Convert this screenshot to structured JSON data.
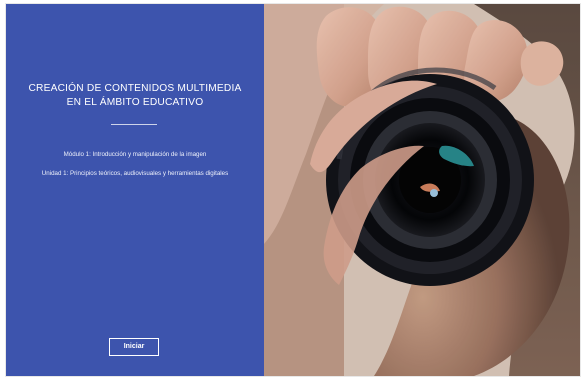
{
  "course": {
    "title": "CREACIÓN DE CONTENIDOS MULTIMEDIA EN EL ÁMBITO EDUCATIVO",
    "module": "Módulo 1: Introducción y manipulación de la imagen",
    "unit": "Unidad 1: Principios teóricos, audiovisuales y herramientas digitales"
  },
  "actions": {
    "start_label": "Iniciar"
  },
  "theme": {
    "panel_color": "#3d54ad",
    "text_color": "#ffffff"
  },
  "hero_image": {
    "subject": "photographer holding camera lens",
    "icon": "camera-photo-icon"
  }
}
